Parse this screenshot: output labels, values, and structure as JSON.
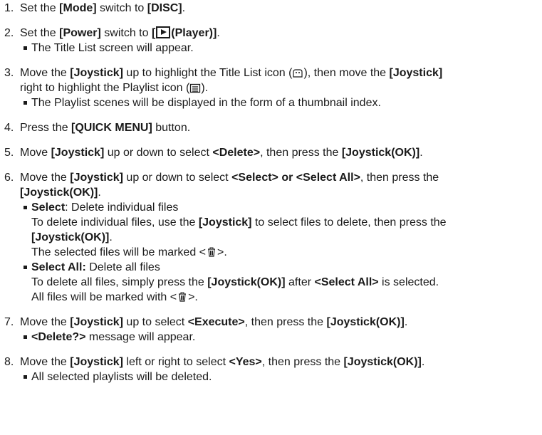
{
  "steps": [
    {
      "num": "1.",
      "pre": "Set the ",
      "b1": "[Mode]",
      "mid": " switch to ",
      "b2": "[DISC]",
      "post": "."
    },
    {
      "num": "2.",
      "pre": "Set the ",
      "b1": "[Power]",
      "mid": " switch to ",
      "b2_open": "[",
      "b2_close": "(Player)]",
      "post": ".",
      "bullet": "The Title List screen will appear."
    },
    {
      "num": "3.",
      "line1_pre": "Move the ",
      "line1_b1": "[Joystick]",
      "line1_mid": " up to highlight the Title List icon (",
      "line1_post": "), then move the ",
      "line1_b2": "[Joystick]",
      "line2_pre": "right to highlight the Playlist icon (",
      "line2_post": ").",
      "bullet": "The Playlist scenes will be displayed in the form of a thumbnail index."
    },
    {
      "num": "4.",
      "pre": "Press the ",
      "b1": "[QUICK MENU]",
      "post": " button."
    },
    {
      "num": "5.",
      "pre": "Move ",
      "b1": "[Joystick]",
      "mid": " up or down to select ",
      "b2": "<Delete>",
      "mid2": ", then press the ",
      "b3": "[Joystick(OK)]",
      "post": "."
    },
    {
      "num": "6.",
      "line1_pre": "Move the ",
      "line1_b1": "[Joystick]",
      "line1_mid": " up or down to select ",
      "line1_b2": "<Select> or <Select All>",
      "line1_post": ", then press the",
      "line2_b": "[Joystick(OK)]",
      "line2_post": ".",
      "select": {
        "label": "Select",
        "label_rest": ": Delete individual files",
        "line2_pre": "To delete individual files, use the ",
        "line2_b": "[Joystick]",
        "line2_post": " to select files to delete, then press the",
        "line3_b": "[Joystick(OK)]",
        "line3_post": ".",
        "line4_pre": "The selected files will be marked <",
        "line4_post": ">."
      },
      "select_all": {
        "label": "Select All:",
        "label_rest": " Delete all files",
        "line2_pre": "To delete all files, simply press the ",
        "line2_b": "[Joystick(OK)]",
        "line2_mid": " after ",
        "line2_b2": "<Select All>",
        "line2_post": " is selected.",
        "line3_pre": "All files will be marked with <",
        "line3_post": ">."
      }
    },
    {
      "num": "7.",
      "pre": "Move the ",
      "b1": "[Joystick]",
      "mid": " up to select ",
      "b2": "<Execute>",
      "mid2": ", then press the ",
      "b3": "[Joystick(OK)]",
      "post": ".",
      "bullet_b": "<Delete?>",
      "bullet_post": " message will appear."
    },
    {
      "num": "8.",
      "pre": "Move the ",
      "b1": "[Joystick]",
      "mid": " left or right to select ",
      "b2": "<Yes>",
      "mid2": ", then press the ",
      "b3": "[Joystick(OK)]",
      "post": ".",
      "bullet": "All selected playlists will be deleted."
    }
  ]
}
